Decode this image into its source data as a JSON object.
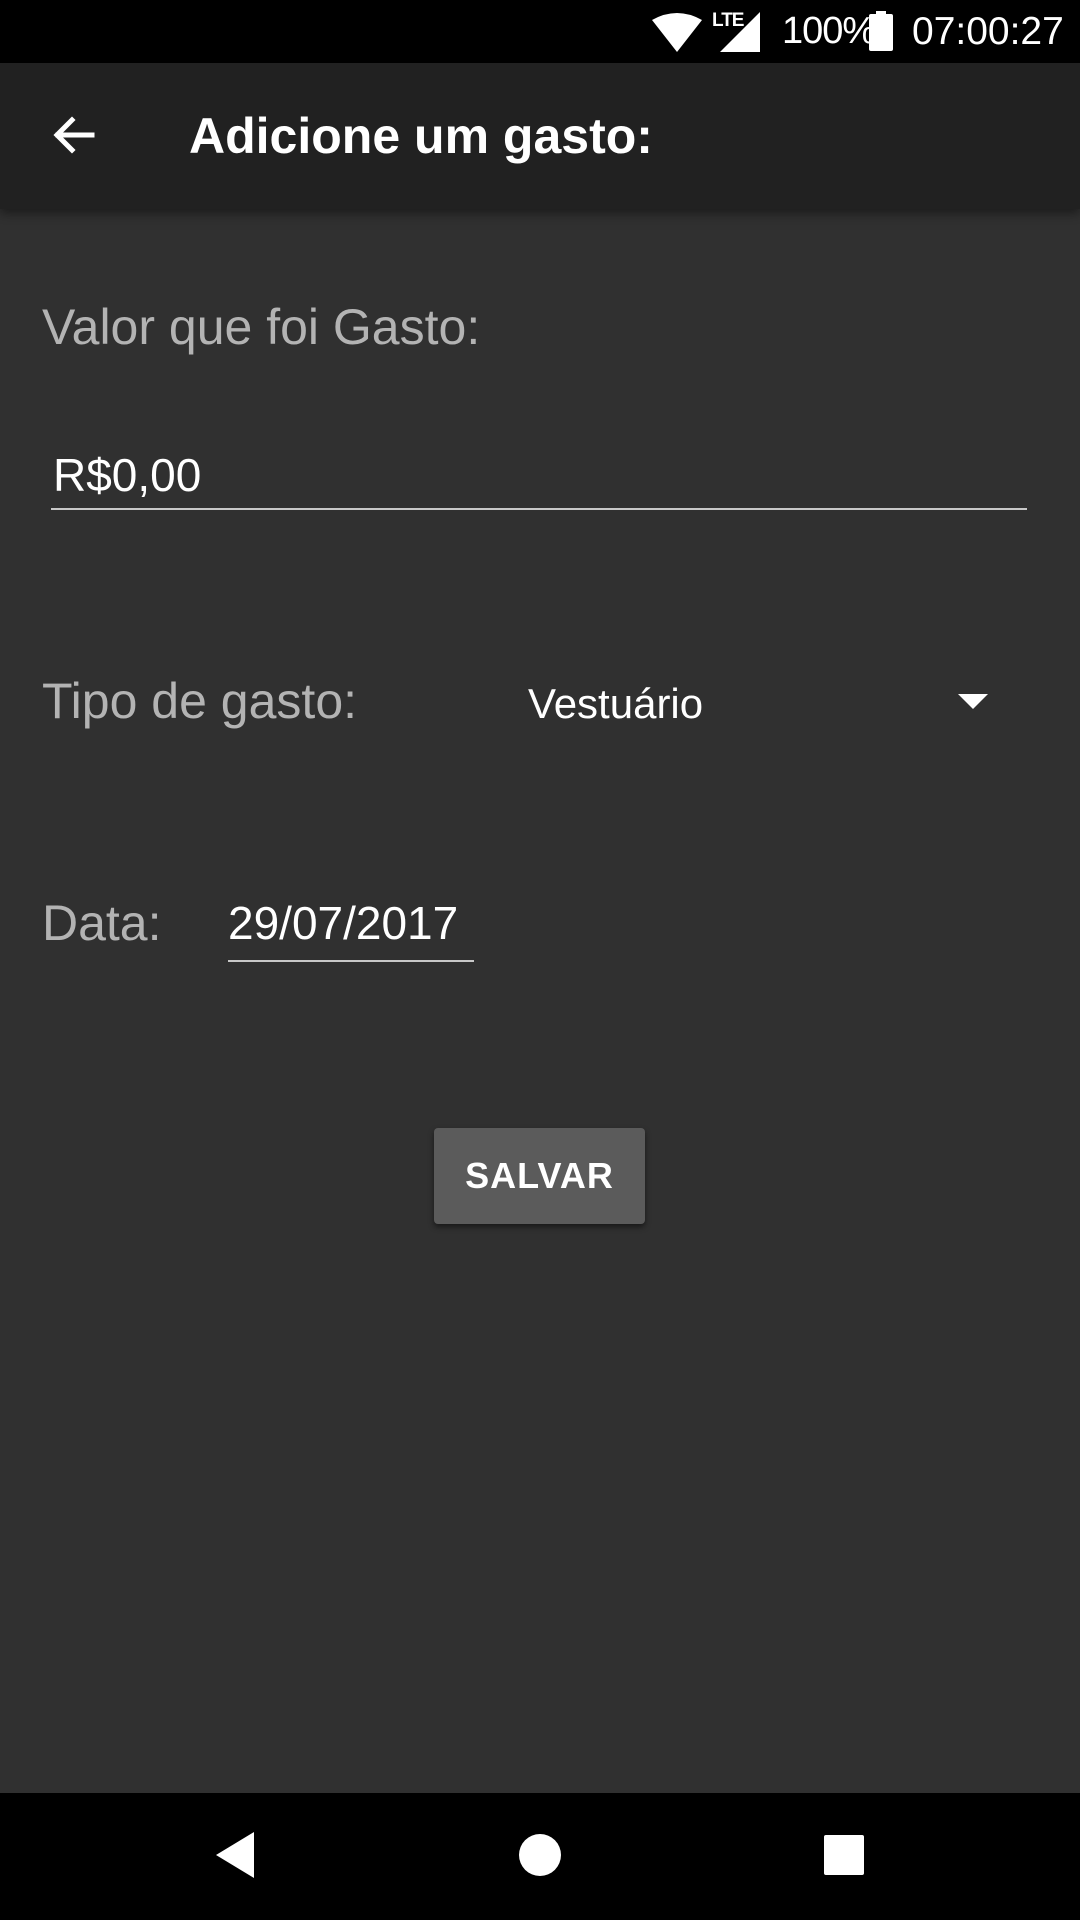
{
  "status_bar": {
    "network_label": "LTE",
    "battery_percent": "100%",
    "time": "07:00:27",
    "icons": [
      "wifi-icon",
      "cell-signal-icon",
      "battery-icon"
    ]
  },
  "app_bar": {
    "title": "Adicione um gasto:",
    "back_icon": "arrow-back-icon"
  },
  "form": {
    "valor_label": "Valor que foi Gasto:",
    "valor_value": "R$0,00",
    "tipo_label": "Tipo de gasto:",
    "tipo_selected": "Vestuário",
    "data_label": "Data:",
    "data_value": "29/07/2017"
  },
  "actions": {
    "save_label": "SALVAR"
  },
  "nav_bar": {
    "icons": [
      "nav-back-icon",
      "nav-home-icon",
      "nav-recents-icon"
    ]
  },
  "colors": {
    "background": "#303030",
    "app_bar": "#212121",
    "status_bar": "#000000",
    "label_text": "#b3b3b3",
    "button": "#5b5b5b"
  }
}
